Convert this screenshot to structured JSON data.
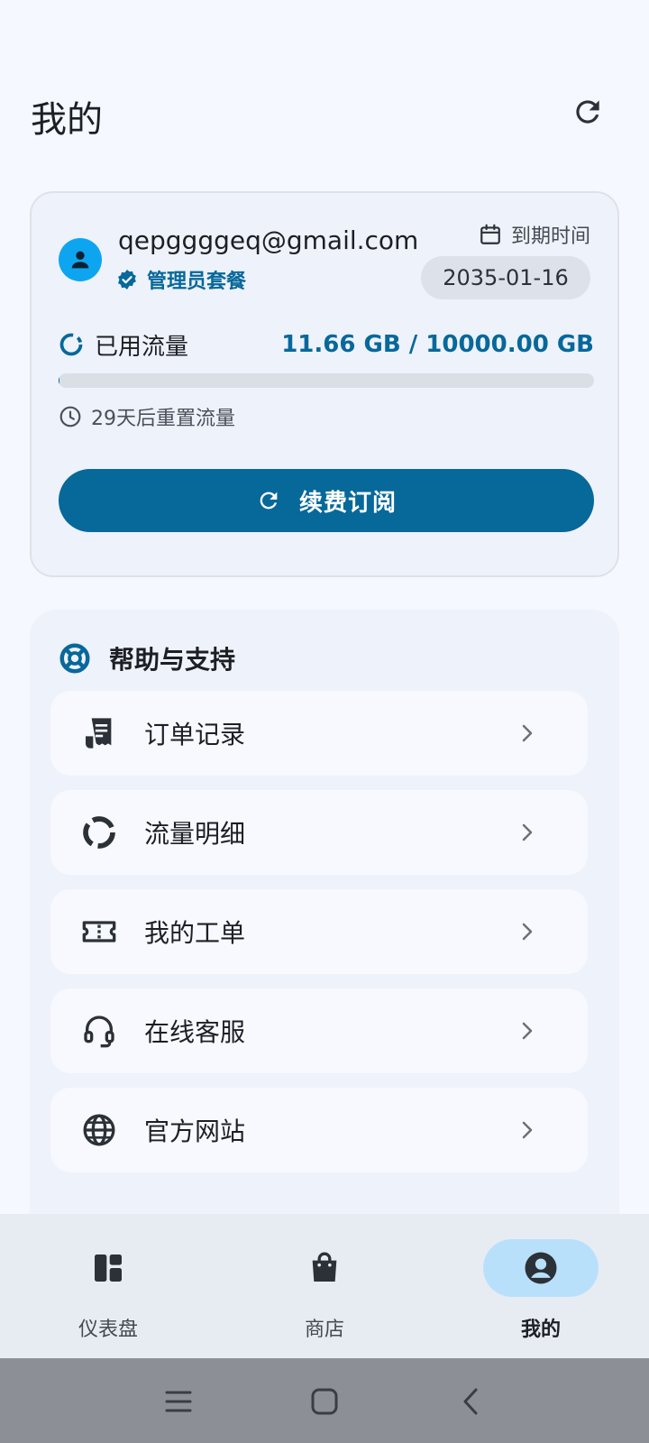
{
  "header": {
    "title": "我的"
  },
  "account": {
    "email": "qepggggeq@gmail.com",
    "plan": "管理员套餐",
    "expiry_label": "到期时间",
    "expiry_date": "2035-01-16",
    "usage_label": "已用流量",
    "usage_value": "11.66 GB / 10000.00 GB",
    "usage_fraction": 0.001166,
    "reset_text": "29天后重置流量",
    "renew_label": "续费订阅"
  },
  "support": {
    "title": "帮助与支持",
    "items": [
      {
        "label": "订单记录",
        "icon": "receipt-icon"
      },
      {
        "label": "流量明细",
        "icon": "donut-chart-icon"
      },
      {
        "label": "我的工单",
        "icon": "ticket-icon"
      },
      {
        "label": "在线客服",
        "icon": "headset-icon"
      },
      {
        "label": "官方网站",
        "icon": "globe-icon"
      }
    ]
  },
  "bottom_nav": {
    "items": [
      {
        "label": "仪表盘",
        "icon": "dashboard-icon"
      },
      {
        "label": "商店",
        "icon": "shopping-bag-icon"
      },
      {
        "label": "我的",
        "icon": "account-icon",
        "active": true
      }
    ]
  },
  "colors": {
    "accent": "#07689a",
    "avatar": "#0ea5f0",
    "active_nav": "#b9e0fb"
  }
}
